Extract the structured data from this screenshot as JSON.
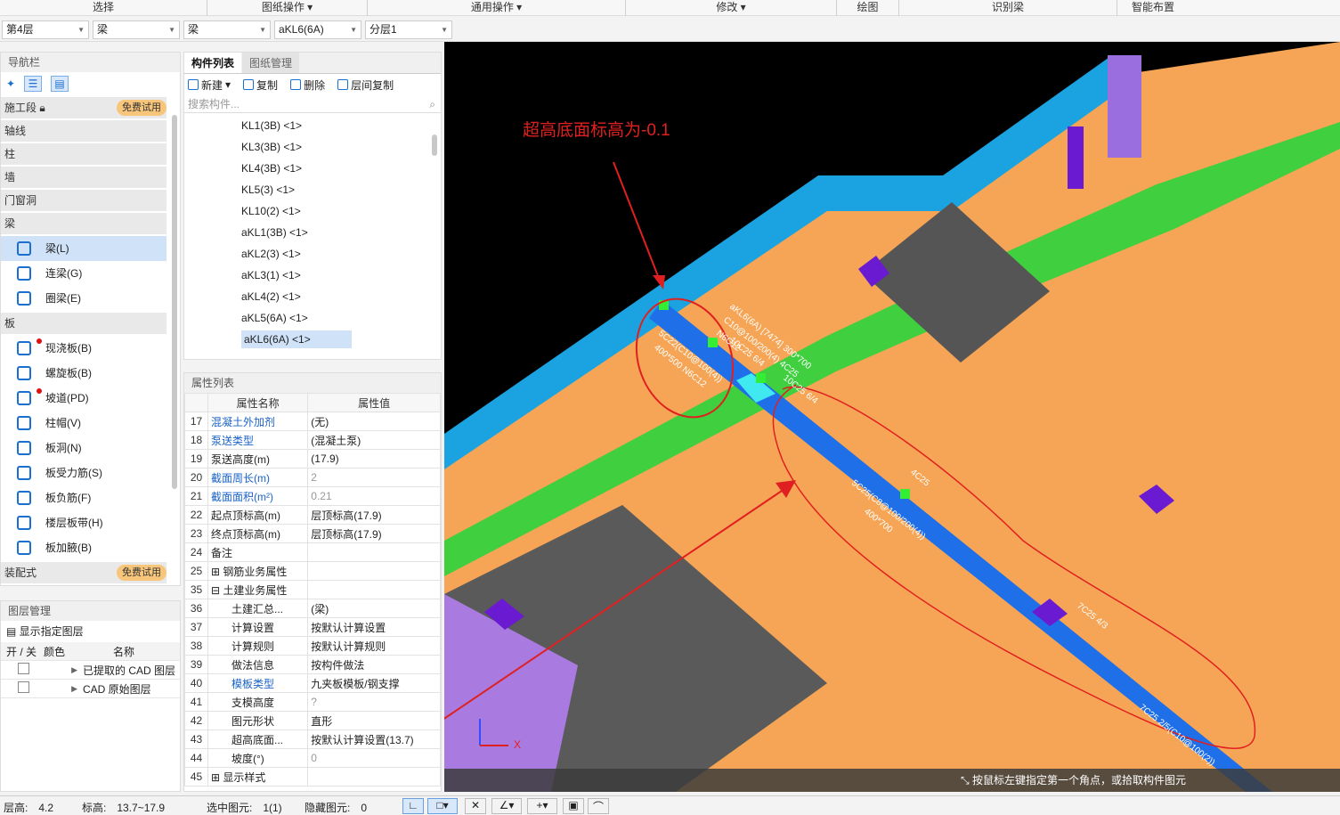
{
  "ribbon": [
    "选择",
    "图纸操作 ▾",
    "通用操作 ▾",
    "修改 ▾",
    "绘图",
    "识别梁",
    "智能布置"
  ],
  "selectors": {
    "floor": "第4层",
    "type1": "梁",
    "type2": "梁",
    "component": "aKL6(6A)",
    "sublayer": "分层1"
  },
  "nav": {
    "title": "导航栏",
    "categories": {
      "construction": "施工段",
      "axis": "轴线",
      "column": "柱",
      "wall": "墙",
      "door": "门窗洞",
      "beam": "梁",
      "slab": "板",
      "precast": "装配式"
    },
    "trial_badge": "免费试用",
    "beam_items": [
      "梁(L)",
      "连梁(G)",
      "圈梁(E)"
    ],
    "slab_items": [
      "现浇板(B)",
      "螺旋板(B)",
      "坡道(PD)",
      "柱帽(V)",
      "板洞(N)",
      "板受力筋(S)",
      "板负筋(F)",
      "楼层板带(H)",
      "板加腋(B)"
    ]
  },
  "component_panel": {
    "tabs": [
      "构件列表",
      "图纸管理"
    ],
    "tools": [
      "新建",
      "复制",
      "删除",
      "层间复制"
    ],
    "search_placeholder": "搜索构件...",
    "items": [
      "KL1(3B) <1>",
      "KL3(3B) <1>",
      "KL4(3B) <1>",
      "KL5(3) <1>",
      "KL10(2) <1>",
      "aKL1(3B) <1>",
      "aKL2(3) <1>",
      "aKL3(1) <1>",
      "aKL4(2) <1>",
      "aKL5(6A) <1>",
      "aKL6(6A) <1>"
    ]
  },
  "props": {
    "title": "属性列表",
    "col_name": "属性名称",
    "col_value": "属性值",
    "rows": [
      {
        "n": "17",
        "name": "混凝土外加剂",
        "value": "(无)"
      },
      {
        "n": "18",
        "name": "泵送类型",
        "value": "(混凝土泵)"
      },
      {
        "n": "19",
        "name": "泵送高度(m)",
        "value": "(17.9)"
      },
      {
        "n": "20",
        "name": "截面周长(m)",
        "value": "2"
      },
      {
        "n": "21",
        "name": "截面面积(m²)",
        "value": "0.21"
      },
      {
        "n": "22",
        "name": "起点顶标高(m)",
        "value": "层顶标高(17.9)"
      },
      {
        "n": "23",
        "name": "终点顶标高(m)",
        "value": "层顶标高(17.9)"
      },
      {
        "n": "24",
        "name": "备注",
        "value": ""
      },
      {
        "n": "25",
        "name": "钢筋业务属性",
        "value": ""
      },
      {
        "n": "35",
        "name": "土建业务属性",
        "value": ""
      },
      {
        "n": "36",
        "name": "土建汇总...",
        "value": "(梁)"
      },
      {
        "n": "37",
        "name": "计算设置",
        "value": "按默认计算设置"
      },
      {
        "n": "38",
        "name": "计算规则",
        "value": "按默认计算规则"
      },
      {
        "n": "39",
        "name": "做法信息",
        "value": "按构件做法"
      },
      {
        "n": "40",
        "name": "模板类型",
        "value": "九夹板模板/钢支撑"
      },
      {
        "n": "41",
        "name": "支模高度",
        "value": "?"
      },
      {
        "n": "42",
        "name": "图元形状",
        "value": "直形"
      },
      {
        "n": "43",
        "name": "超高底面...",
        "value": "按默认计算设置(13.7)"
      },
      {
        "n": "44",
        "name": "坡度(°)",
        "value": "0"
      },
      {
        "n": "45",
        "name": "显示样式",
        "value": ""
      }
    ]
  },
  "layers": {
    "title": "图层管理",
    "show_label": "显示指定图层",
    "col_toggle": "开 / 关",
    "col_color": "颜色",
    "col_name": "名称",
    "rows": [
      "已提取的 CAD 图层",
      "CAD 原始图层"
    ]
  },
  "viewport": {
    "annotation": "超高底面标高为-0.1",
    "hint": "按鼠标左键指定第一个角点，或拾取构件图元",
    "beam_labels": [
      "aKL6(6A) [7474] 300*700",
      "C10@100/200(4) 4C25",
      "N6C12",
      "10C25 6/4",
      "5C22(C10@100(4))",
      "400*500 N6C12",
      "10C25 6/4",
      "4C25",
      "5C25(C8@100/200(4))",
      "400*700",
      "7C25 4/3",
      "7C25 2/5(C10@100(2))"
    ],
    "axis_x": "X"
  },
  "status": {
    "floor_height": "层高:　4.2",
    "elevation": "标高:　13.7~17.9",
    "selected": "选中图元:　1(1)",
    "hidden": "隐藏图元:　0"
  }
}
